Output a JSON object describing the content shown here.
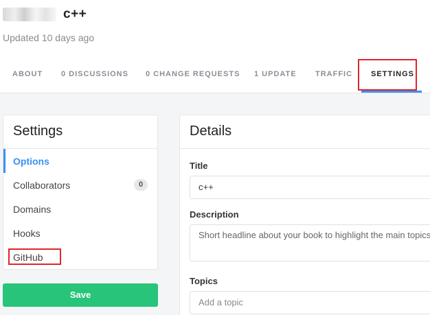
{
  "book": {
    "title": "c++",
    "updated": "Updated 10 days ago"
  },
  "tabs": [
    {
      "label": "ABOUT"
    },
    {
      "label": "0 DISCUSSIONS"
    },
    {
      "label": "0 CHANGE REQUESTS"
    },
    {
      "label": "1 UPDATE"
    },
    {
      "label": "TRAFFIC"
    },
    {
      "label": "SETTINGS",
      "active": true
    }
  ],
  "sidebar": {
    "title": "Settings",
    "items": [
      {
        "label": "Options",
        "active": true
      },
      {
        "label": "Collaborators",
        "count": "0"
      },
      {
        "label": "Domains"
      },
      {
        "label": "Hooks"
      },
      {
        "label": "GitHub"
      }
    ],
    "save_label": "Save"
  },
  "details": {
    "title": "Details",
    "fields": {
      "title_label": "Title",
      "title_value": "c++",
      "description_label": "Description",
      "description_placeholder": "Short headline about your book to highlight the main topics",
      "topics_label": "Topics",
      "topics_placeholder": "Add a topic"
    }
  },
  "colors": {
    "accent": "#3b8ff0",
    "save_button": "#27c47a",
    "highlight": "#e0242c"
  }
}
